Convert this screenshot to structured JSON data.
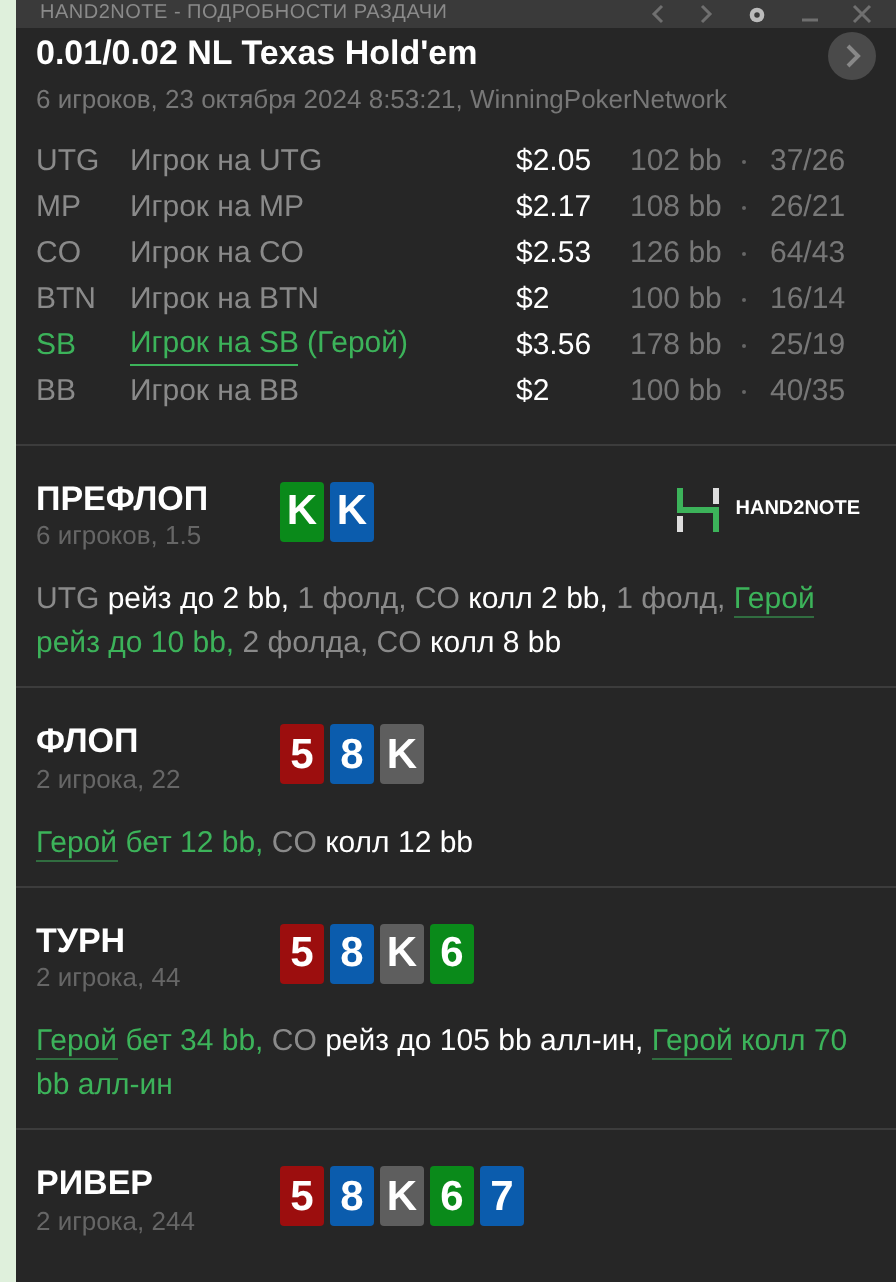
{
  "window": {
    "title": "HAND2NOTE - ПОДРОБНОСТИ РАЗДАЧИ"
  },
  "hand": {
    "title": "0.01/0.02 NL Texas Hold'em",
    "subtitle": "6 игроков, 23 октября 2024 8:53:21, WinningPokerNetwork"
  },
  "players": [
    {
      "position": "UTG",
      "name": "Игрок на UTG",
      "hero": false,
      "stack": "$2.05",
      "bb": "102 bb",
      "stats": "37/26"
    },
    {
      "position": "MP",
      "name": "Игрок на MP",
      "hero": false,
      "stack": "$2.17",
      "bb": "108 bb",
      "stats": "26/21"
    },
    {
      "position": "CO",
      "name": "Игрок на CO",
      "hero": false,
      "stack": "$2.53",
      "bb": "126 bb",
      "stats": "64/43"
    },
    {
      "position": "BTN",
      "name": "Игрок на BTN",
      "hero": false,
      "stack": "$2",
      "bb": "100 bb",
      "stats": "16/14"
    },
    {
      "position": "SB",
      "name": "Игрок на SB",
      "hero": true,
      "hero_tag": "(Герой)",
      "stack": "$3.56",
      "bb": "178 bb",
      "stats": "25/19"
    },
    {
      "position": "BB",
      "name": "Игрок на BB",
      "hero": false,
      "stack": "$2",
      "bb": "100 bb",
      "stats": "40/35"
    }
  ],
  "streets": [
    {
      "name": "ПРЕФЛОП",
      "info": "6 игроков, 1.5",
      "logo": {
        "text": "HAND2NOTE"
      },
      "cards": [
        {
          "rank": "K",
          "color": "#0a8a1a"
        },
        {
          "rank": "K",
          "color": "#0b5cad"
        }
      ],
      "actions": [
        {
          "kind": "player",
          "text": "UTG"
        },
        {
          "kind": "action",
          "text": "рейз до 2 bb,"
        },
        {
          "kind": "player",
          "text": "1 фолд, CO"
        },
        {
          "kind": "action",
          "text": "колл 2 bb,"
        },
        {
          "kind": "player",
          "text": "1 фолд,"
        },
        {
          "kind": "hero",
          "text": "Герой"
        },
        {
          "kind": "hero_action",
          "text": "рейз до 10 bb,"
        },
        {
          "kind": "player",
          "text": "2 фолда, CO"
        },
        {
          "kind": "action",
          "text": "колл 8 bb"
        }
      ]
    },
    {
      "name": "ФЛОП",
      "info": "2 игрока, 22",
      "cards": [
        {
          "rank": "5",
          "color": "#9c0e0e"
        },
        {
          "rank": "8",
          "color": "#0b5cad"
        },
        {
          "rank": "K",
          "color": "#5e5e5e"
        }
      ],
      "actions": [
        {
          "kind": "hero",
          "text": "Герой"
        },
        {
          "kind": "hero_action",
          "text": "бет 12 bb,"
        },
        {
          "kind": "player",
          "text": "CO"
        },
        {
          "kind": "action",
          "text": "колл 12 bb"
        }
      ]
    },
    {
      "name": "ТУРН",
      "info": "2 игрока, 44",
      "cards": [
        {
          "rank": "5",
          "color": "#9c0e0e"
        },
        {
          "rank": "8",
          "color": "#0b5cad"
        },
        {
          "rank": "K",
          "color": "#5e5e5e"
        },
        {
          "rank": "6",
          "color": "#0a8a1a"
        }
      ],
      "actions": [
        {
          "kind": "hero",
          "text": "Герой"
        },
        {
          "kind": "hero_action",
          "text": "бет 34 bb,"
        },
        {
          "kind": "player",
          "text": "CO"
        },
        {
          "kind": "action",
          "text": "рейз до 105 bb алл-ин,"
        },
        {
          "kind": "hero",
          "text": "Герой"
        },
        {
          "kind": "hero_action",
          "text": "колл 70 bb алл-ин"
        }
      ]
    },
    {
      "name": "РИВЕР",
      "info": "2 игрока, 244",
      "cards": [
        {
          "rank": "5",
          "color": "#9c0e0e"
        },
        {
          "rank": "8",
          "color": "#0b5cad"
        },
        {
          "rank": "K",
          "color": "#5e5e5e"
        },
        {
          "rank": "6",
          "color": "#0a8a1a"
        },
        {
          "rank": "7",
          "color": "#0b5cad"
        }
      ]
    }
  ]
}
